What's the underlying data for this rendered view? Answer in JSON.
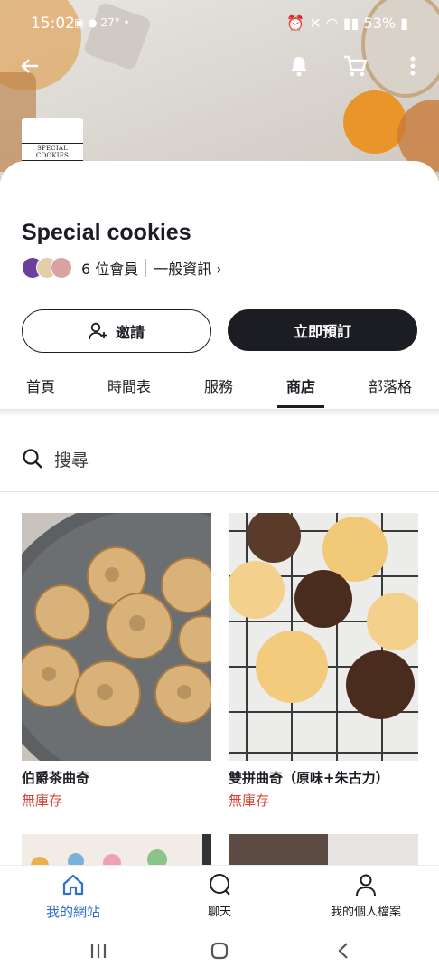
{
  "status_bar": {
    "time": "15:02",
    "temperature": "27°",
    "battery": "53%"
  },
  "header": {
    "logo_text": "SPECIAL COOKIES",
    "site_title": "Special cookies",
    "members": "6 位會員",
    "info_link": "一般資訊"
  },
  "actions": {
    "invite_label": "邀請",
    "book_label": "立即預訂"
  },
  "tabs": [
    {
      "label": "首頁"
    },
    {
      "label": "時間表"
    },
    {
      "label": "服務"
    },
    {
      "label": "商店",
      "active": true
    },
    {
      "label": "部落格"
    }
  ],
  "search": {
    "label": "搜尋"
  },
  "products": [
    {
      "name": "伯爵茶曲奇",
      "stock": "無庫存"
    },
    {
      "name": "雙拼曲奇（原味+朱古力）",
      "stock": "無庫存"
    }
  ],
  "bottom_nav": [
    {
      "label": "我的網站",
      "icon": "home-icon",
      "active": true
    },
    {
      "label": "聊天",
      "icon": "chat-icon"
    },
    {
      "label": "我的個人檔案",
      "icon": "profile-icon"
    }
  ],
  "colors": {
    "primary_dark": "#1b1d23",
    "stock_red": "#d6453a",
    "active_blue": "#2f6fcf"
  }
}
